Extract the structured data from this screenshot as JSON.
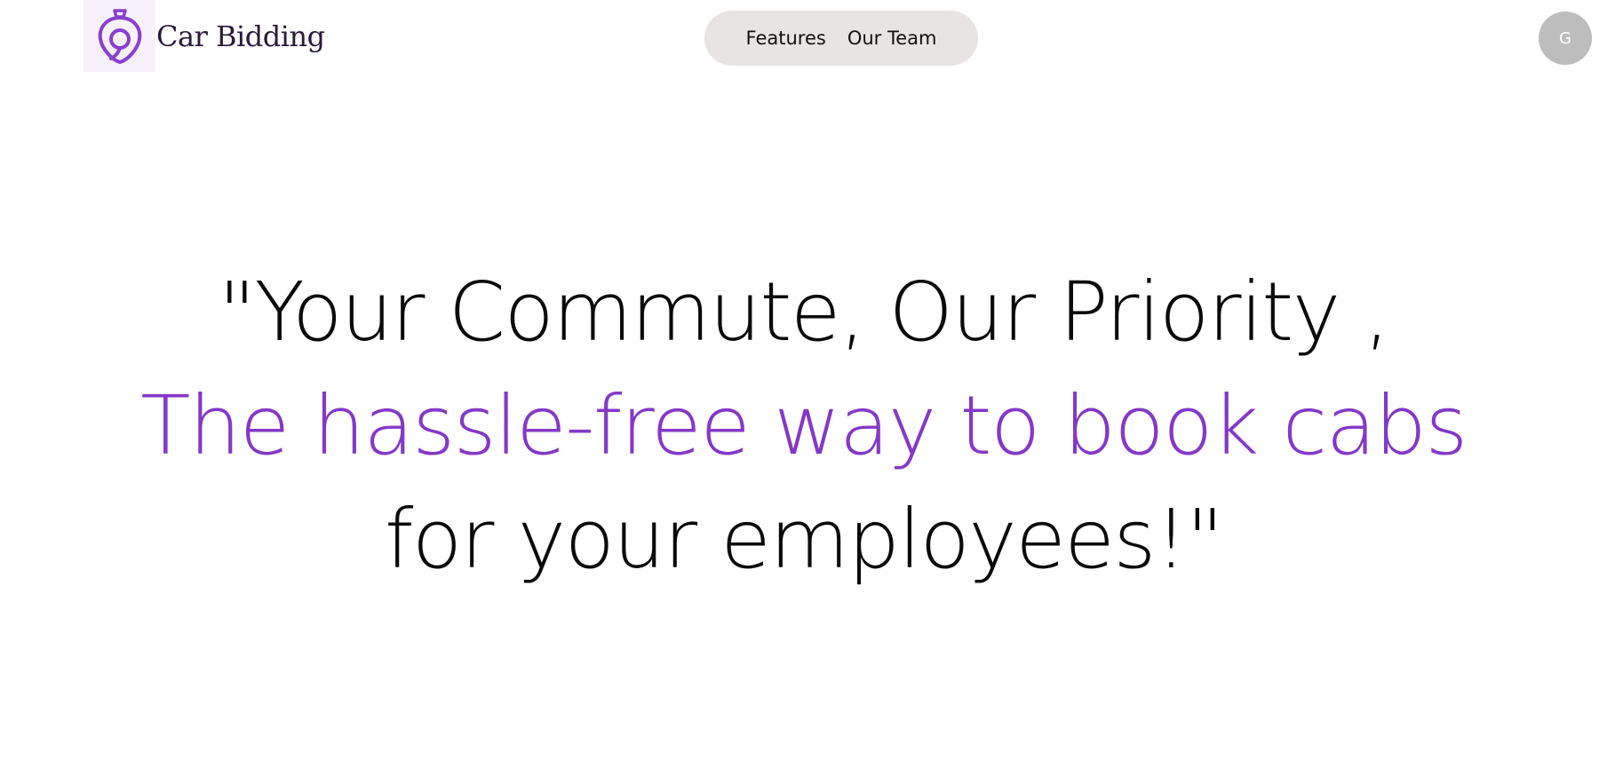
{
  "header": {
    "brand_name": "Car Bidding",
    "logo_icon": "pin-logo-icon",
    "nav": [
      {
        "label": "Features"
      },
      {
        "label": "Our Team"
      }
    ],
    "avatar_initial": "G"
  },
  "hero": {
    "line1": "\"Your Commute, Our Priority ,",
    "line2": "The hassle-free way to book cabs",
    "line3": "for your employees!\""
  },
  "colors": {
    "accent": "#8438c8",
    "nav_pill_bg": "#e8e4e4",
    "avatar_bg": "#bdbdbd",
    "text_dark": "#0a0a0a"
  }
}
